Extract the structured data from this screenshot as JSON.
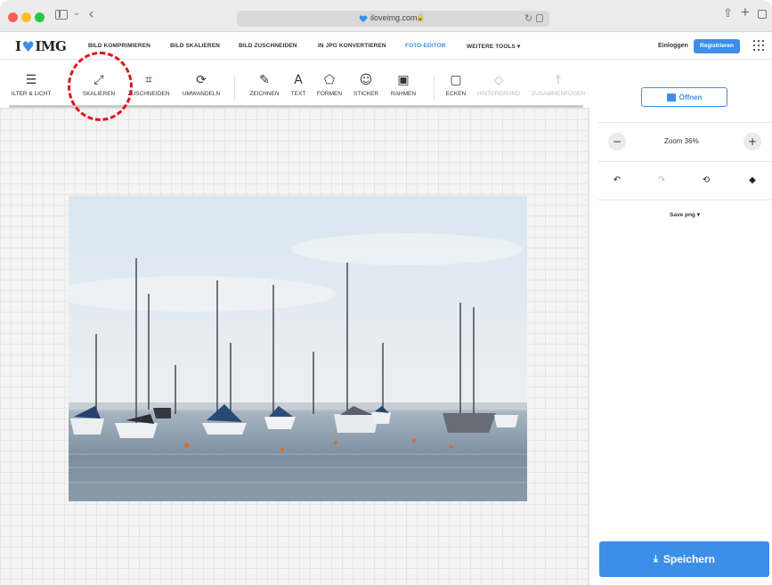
{
  "browser": {
    "url": "iloveimg.com"
  },
  "nav": {
    "logo_left": "I",
    "logo_right": "IMG",
    "items": [
      {
        "label": "BILD KOMPRIMIEREN"
      },
      {
        "label": "BILD SKALIEREN"
      },
      {
        "label": "BILD ZUSCHNEIDEN"
      },
      {
        "label": "IN JPG KONVERTIEREN"
      },
      {
        "label": "FOTO-EDITOR",
        "active": true
      },
      {
        "label": "WEITERE TOOLS ▾"
      }
    ],
    "login": "Einloggen",
    "register": "Registrieren"
  },
  "toolbar": {
    "tools": [
      {
        "label": "ILTER & LICHT",
        "icon": "sliders-icon"
      },
      {
        "label": "SKALIEREN",
        "icon": "resize-icon"
      },
      {
        "label": "ZUSCHNEIDEN",
        "icon": "crop-icon"
      },
      {
        "label": "UMWANDELN",
        "icon": "transform-icon"
      },
      {
        "label": "ZEICHNEN",
        "icon": "pencil-icon"
      },
      {
        "label": "TEXT",
        "icon": "text-icon"
      },
      {
        "label": "FORMEN",
        "icon": "shapes-icon"
      },
      {
        "label": "STICKER",
        "icon": "sticker-icon"
      },
      {
        "label": "RAHMEN",
        "icon": "frame-icon"
      },
      {
        "label": "ECKEN",
        "icon": "corners-icon"
      },
      {
        "label": "HINTERGRUND",
        "icon": "background-icon",
        "disabled": true
      },
      {
        "label": "ZUSAMMENFÜGEN",
        "icon": "merge-icon",
        "disabled": true
      }
    ]
  },
  "panel": {
    "open_label": "Öffnen",
    "zoom_label": "Zoom 36%",
    "save_type": "Save png ▾",
    "save_label": "Speichern"
  },
  "colors": {
    "accent": "#3c8fe7",
    "highlight": "#e0141e"
  }
}
